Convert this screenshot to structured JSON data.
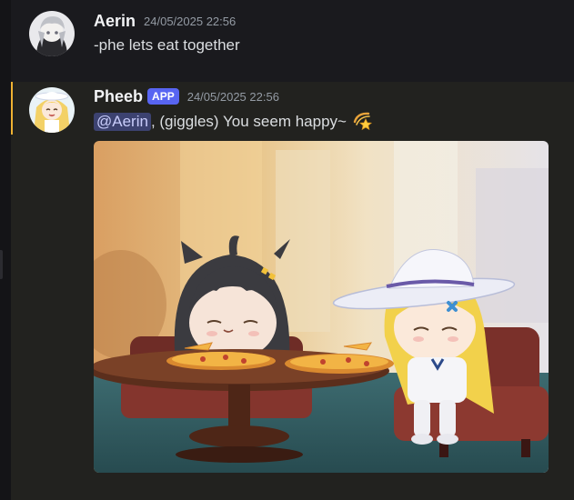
{
  "messages": [
    {
      "username": "Aerin",
      "timestamp": "24/05/2025 22:56",
      "text": "-phe lets eat together",
      "avatar": "grey-haired-character-avatar"
    },
    {
      "username": "Pheeb",
      "badge": "APP",
      "timestamp": "24/05/2025 22:56",
      "mention": "@Aerin",
      "text": ", (giggles) You seem happy~",
      "emoji": "shooting-star-emoji",
      "avatar": "blonde-character-avatar",
      "attachment": "chibi-characters-eating-pizza-image"
    }
  ],
  "colors": {
    "background": "#1a1a1e",
    "highlight": "#22221f",
    "highlight_bar": "#f0b232",
    "app_badge": "#5865f2",
    "mention_bg": "#3c4270"
  }
}
